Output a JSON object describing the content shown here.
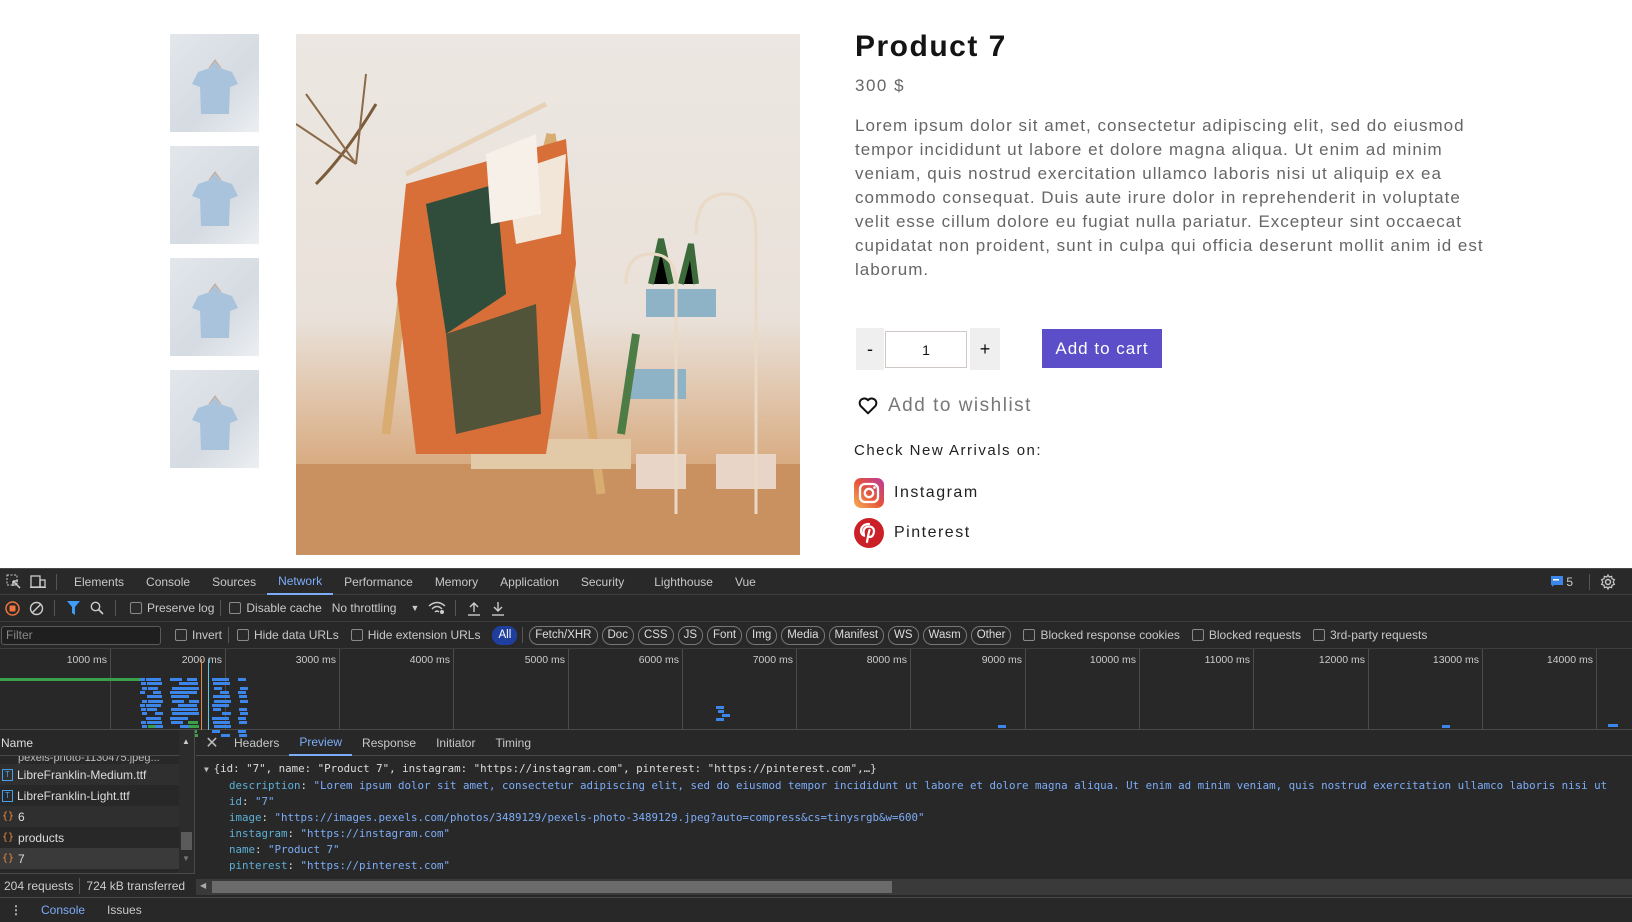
{
  "product": {
    "title": "Product 7",
    "price": "300 $",
    "description": "Lorem ipsum dolor sit amet, consectetur adipiscing elit, sed do eiusmod tempor incididunt ut labore et dolore magna aliqua. Ut enim ad minim veniam, quis nostrud exercitation ullamco laboris nisi ut aliquip ex ea commodo consequat. Duis aute irure dolor in reprehenderit in voluptate velit esse cillum dolore eu fugiat nulla pariatur. Excepteur sint occaecat cupidatat non proident, sunt in culpa qui officia deserunt mollit anim id est laborum.",
    "thumbnail_count": 4,
    "quantity": "1",
    "minus_label": "-",
    "plus_label": "+",
    "add_to_cart": "Add to cart",
    "add_to_wishlist": "Add to wishlist",
    "arrivals_label": "Check New Arrivals on:",
    "socials": [
      {
        "name": "Instagram",
        "icon": "instagram-icon"
      },
      {
        "name": "Pinterest",
        "icon": "pinterest-icon"
      }
    ],
    "colors": {
      "cart_button": "#5b4ec8"
    }
  },
  "devtools": {
    "tabs": [
      "Elements",
      "Console",
      "Sources",
      "Network",
      "Performance",
      "Memory",
      "Application",
      "Security",
      "Lighthouse",
      "Vue"
    ],
    "active_tab": "Network",
    "issues_count": "5",
    "toolbar": {
      "preserve_log": "Preserve log",
      "disable_cache": "Disable cache",
      "throttling": "No throttling"
    },
    "filter": {
      "placeholder": "Filter",
      "invert": "Invert",
      "hide_data_urls": "Hide data URLs",
      "hide_extension_urls": "Hide extension URLs",
      "types": [
        "All",
        "Fetch/XHR",
        "Doc",
        "CSS",
        "JS",
        "Font",
        "Img",
        "Media",
        "Manifest",
        "WS",
        "Wasm",
        "Other"
      ],
      "active_type": "All",
      "blocked_response_cookies": "Blocked response cookies",
      "blocked_requests": "Blocked requests",
      "third_party": "3rd-party requests"
    },
    "timeline": {
      "ticks": [
        "1000 ms",
        "2000 ms",
        "3000 ms",
        "4000 ms",
        "5000 ms",
        "6000 ms",
        "7000 ms",
        "8000 ms",
        "9000 ms",
        "10000 ms",
        "11000 ms",
        "12000 ms",
        "13000 ms",
        "14000 ms"
      ]
    },
    "requests": {
      "header": "Name",
      "rows": [
        {
          "name": "pexels-photo-1130475.jpeg...",
          "type": "img"
        },
        {
          "name": "LibreFranklin-Medium.ttf",
          "type": "font"
        },
        {
          "name": "LibreFranklin-Light.ttf",
          "type": "font"
        },
        {
          "name": "6",
          "type": "fetch"
        },
        {
          "name": "products",
          "type": "fetch"
        },
        {
          "name": "7",
          "type": "fetch"
        }
      ],
      "selected": "7",
      "summary_requests": "204 requests",
      "summary_transferred": "724 kB transferred"
    },
    "detail_tabs": [
      "Headers",
      "Preview",
      "Response",
      "Initiator",
      "Timing"
    ],
    "active_detail_tab": "Preview",
    "preview": {
      "summary": "{id: \"7\", name: \"Product 7\", instagram: \"https://instagram.com\", pinterest: \"https://pinterest.com\",…}",
      "fields": [
        {
          "key": "description",
          "value": "\"Lorem ipsum dolor sit amet, consectetur adipiscing elit, sed do eiusmod tempor incididunt ut labore et dolore magna aliqua. Ut enim ad minim veniam, quis nostrud exercitation ullamco laboris nisi ut"
        },
        {
          "key": "id",
          "value": "\"7\""
        },
        {
          "key": "image",
          "value": "\"https://images.pexels.com/photos/3489129/pexels-photo-3489129.jpeg?auto=compress&cs=tinysrgb&w=600\""
        },
        {
          "key": "instagram",
          "value": "\"https://instagram.com\""
        },
        {
          "key": "name",
          "value": "\"Product 7\""
        },
        {
          "key": "pinterest",
          "value": "\"https://pinterest.com\""
        }
      ]
    },
    "drawer_tabs": [
      "Console",
      "Issues"
    ]
  }
}
